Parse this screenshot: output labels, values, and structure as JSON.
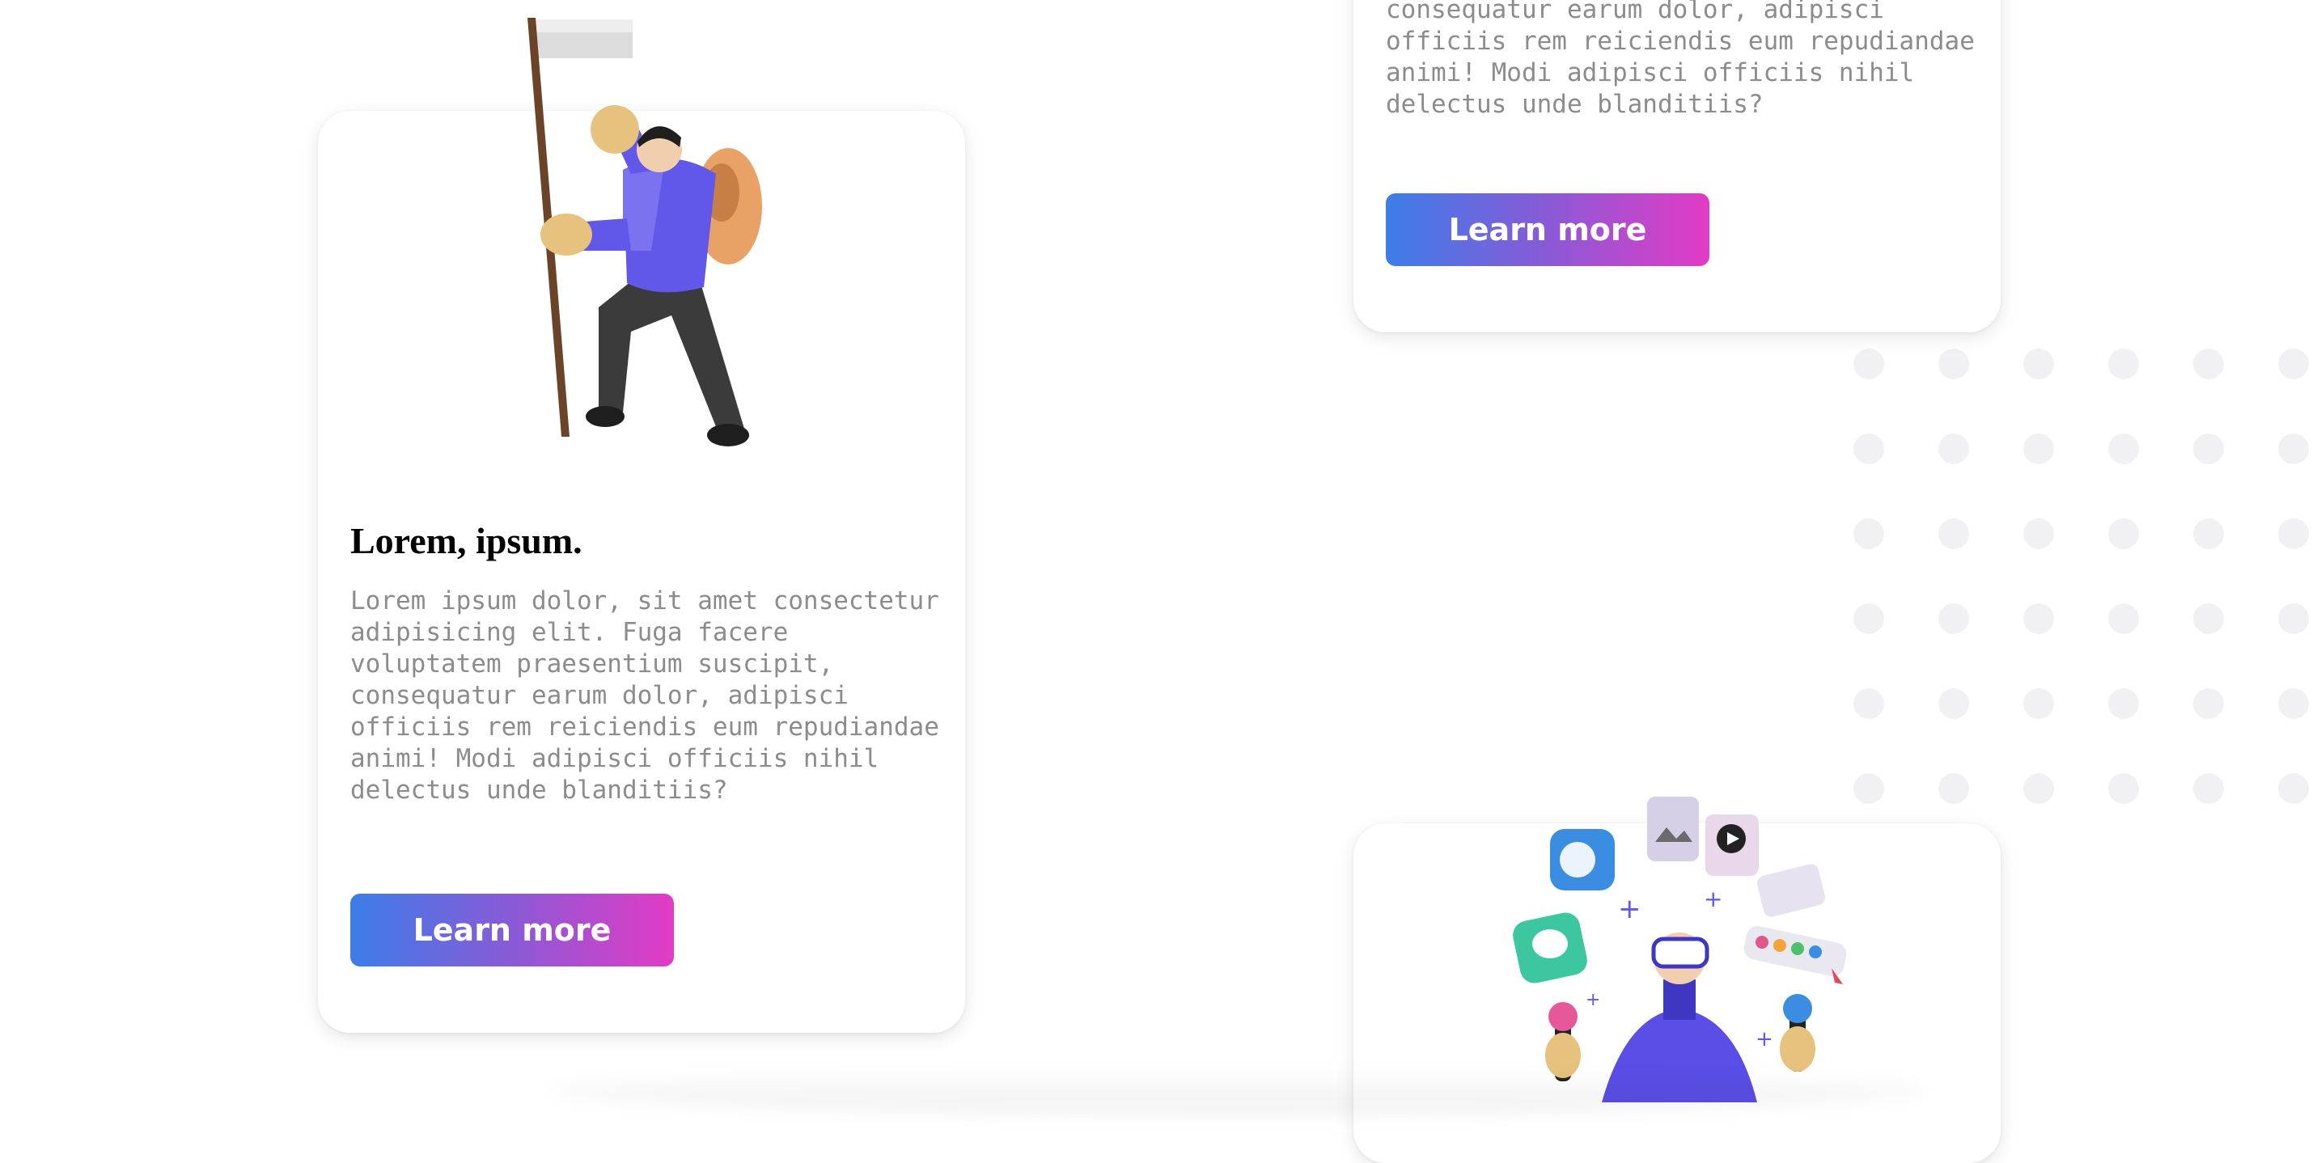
{
  "cards": {
    "left": {
      "title": "Lorem, ipsum.",
      "text": "Lorem ipsum dolor, sit amet consectetur\nadipisicing elit. Fuga facere\nvoluptatem praesentium suscipit,\nconsequatur earum dolor, adipisci\nofficiis rem reiciendis eum repudiandae\nanimi! Modi adipisci officiis nihil\ndelectus unde blanditiis?",
      "button_label": "Learn more",
      "illustration": "hiker-with-flag-illustration"
    },
    "right_top": {
      "text": "consequatur earum dolor, adipisci\nofficiis rem reiciendis eum repudiandae\nanimi! Modi adipisci officiis nihil\ndelectus unde blanditiis?",
      "button_label": "Learn more"
    },
    "right_bottom": {
      "illustration": "vr-user-with-app-icons-illustration"
    }
  },
  "colors": {
    "button_gradient_start": "#3d7de8",
    "button_gradient_end": "#e33bc5",
    "body_text": "#8c8c8c",
    "dot_pattern": "#f1f1f3"
  }
}
